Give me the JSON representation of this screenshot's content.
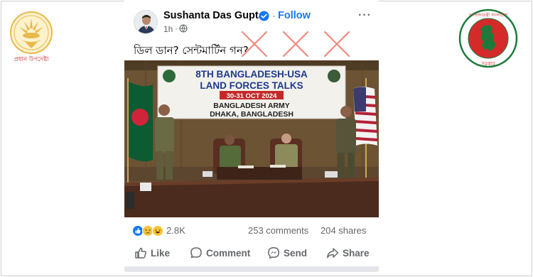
{
  "post": {
    "author": "Sushanta Das Gupta",
    "follow_label": "Follow",
    "time": "1h",
    "separator": "·",
    "more": "···",
    "text": "ডিল ডান? সেন্টমার্টিন গন?"
  },
  "photo": {
    "banner_line1": "8TH BANGLADESH-USA",
    "banner_line2": "LAND FORCES TALKS",
    "banner_dates": "30-31 OCT 2024",
    "banner_line3": "BANGLADESH ARMY",
    "banner_line4": "DHAKA, BANGLADESH"
  },
  "left_seal": {
    "caption": "প্রধান উপদেষ্টা"
  },
  "right_seal": {
    "caption_top": "গণপ্রজাতন্ত্রী বাংলাদেশ",
    "caption_bottom": "সরকার"
  },
  "engagement": {
    "reactions": "2.8K",
    "comments": "253 comments",
    "shares": "204 shares"
  },
  "actions": {
    "like": "Like",
    "comment": "Comment",
    "send": "Send",
    "share": "Share"
  },
  "colors": {
    "link_blue": "#1877f2",
    "secondary_text": "#65676b",
    "cross_red": "#f08a80",
    "seal_gold": "#e8b84a",
    "seal_red": "#d42a2a",
    "seal_green": "#1d7a3a"
  },
  "icons": {
    "verified": "verified-badge-icon",
    "globe": "globe-icon",
    "more": "more-options-icon",
    "like": "thumbs-up-icon",
    "comment": "speech-bubble-icon",
    "send": "messenger-icon",
    "share": "share-arrow-icon"
  }
}
